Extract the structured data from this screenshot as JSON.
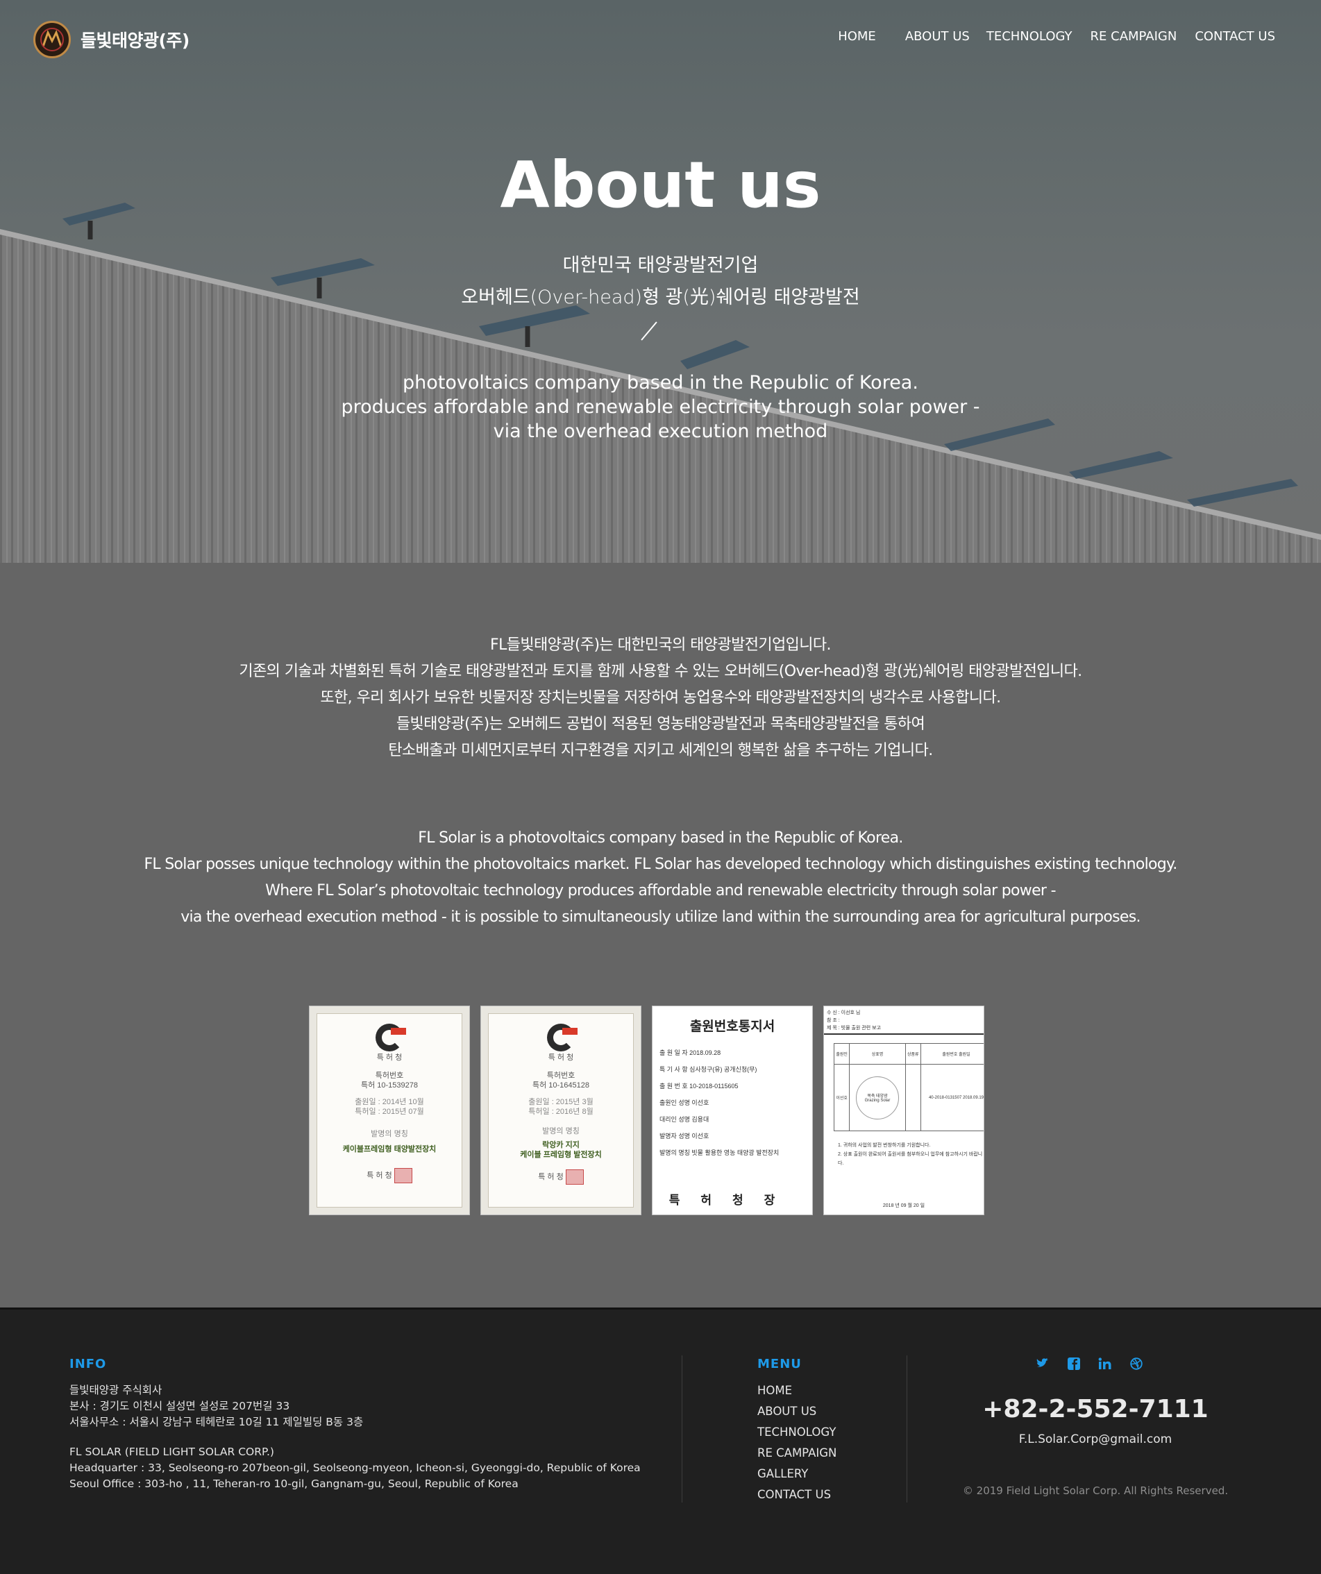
{
  "header": {
    "logo_text": "들빛태양광(주)",
    "nav": [
      "HOME",
      "ABOUT US",
      "TECHNOLOGY",
      "RE CAMPAIGN",
      "CONTACT US"
    ]
  },
  "hero": {
    "title": "About us",
    "ko_lines": [
      "대한민국 태양광발전기업",
      "오버헤드(Over-head)형 광(光)쉐어링 태양광발전"
    ],
    "en_lines": [
      "photovoltaics company based in the Republic of Korea.",
      "produces affordable and renewable electricity through solar power  -",
      "via the overhead execution method"
    ]
  },
  "intro_ko": [
    "FL들빛태양광(주)는 대한민국의 태양광발전기업입니다.",
    "기존의 기술과 차별화된 특허 기술로 태양광발전과 토지를 함께 사용할 수 있는 오버헤드(Over-head)형 광(光)쉐어링 태양광발전입니다.",
    "또한, 우리 회사가 보유한 빗물저장 장치는빗물을 저장하여 농업용수와 태양광발전장치의 냉각수로 사용합니다.",
    "들빛태양광(주)는 오버헤드 공법이 적용된 영농태양광발전과 목축태양광발전을 통하여",
    "탄소배출과 미세먼지로부터 지구환경을 지키고 세계인의 행복한 삶을 추구하는 기업니다."
  ],
  "intro_en": [
    "FL Solar is a photovoltaics company based in the Republic of Korea.",
    "FL Solar posses unique technology within the photovoltaics market.  FL Solar has developed technology which distinguishes existing technology.",
    "Where FL Solar’s photovoltaic technology produces affordable and renewable electricity through solar power  -",
    "via the overhead execution method - it is possible to simultaneously utilize land within the surrounding area for agricultural purposes."
  ],
  "certificates": {
    "cert1": {
      "office": "특 허 청",
      "number_label": "특허번호",
      "number": "특허 10-1539278",
      "filed": "출원일 : 2014년 10월",
      "granted": "특허일 : 2015년 07월",
      "invention_label": "발명의 명칭",
      "invention": "케이블프레임형 태양발전장치",
      "footer": "특    허    청"
    },
    "cert2": {
      "office": "특 허 청",
      "number_label": "특허번호",
      "number": "특허 10-1645128",
      "filed": "출원일 : 2015년 3월",
      "granted": "특허일 : 2016년 8월",
      "invention_label": "발명의 명칭",
      "invention_line1": "락앙카 지지",
      "invention_line2": "케이블 프레임형 발전장치",
      "footer": "특    허    청"
    },
    "cert3": {
      "title": "출원번호통지서",
      "rows": [
        "출 원 일 자   2018.09.28",
        "특 기 사 항   심사청구(유) 공개신청(무)",
        "출 원 번 호   10-2018-0115605",
        "출원인 성명   이선호",
        "대리인 성명   김용대",
        "발명자 성명   이선호",
        "발명의 명칭   빗물 활용한 영농 태양광 발전장치"
      ],
      "footer": "특허청장"
    },
    "cert4": {
      "memo_lines": [
        "수    신 : 이선호 님",
        "참    조 :",
        "제    목 : 빗물 출원 관련 보고"
      ],
      "headers": [
        "출원인",
        "상표명",
        "상품류",
        "출원번호 출원일"
      ],
      "row": [
        "이선호",
        "목축 태양광 Grazing Solar",
        "",
        "40-2018-0131507 2018.09.19"
      ],
      "notes": [
        "1. 귀하의 사업의 발전 번창하기를 기원합니다.",
        "2. 상표 출원이 완료되어 출원서를 첨부하오니 업무에 참고하시기 바랍니다."
      ],
      "date": "2018 년 09 월 20 일"
    }
  },
  "footer": {
    "info_heading": "INFO",
    "info_ko": [
      "들빛태양광 주식회사",
      "본사 : 경기도 이천시 설성면 설성로 207번길 33",
      "서울사무소 : 서울시 강남구 테헤란로 10길 11 제일빌딩 B동 3층"
    ],
    "info_en": [
      "FL SOLAR (FIELD LIGHT SOLAR CORP.)",
      "Headquarter : 33, Seolseong-ro 207beon-gil, Seolseong-myeon, Icheon-si, Gyeonggi-do, Republic of Korea",
      "Seoul Office : 303-ho , 11, Teheran-ro 10-gil, Gangnam-gu, Seoul, Republic of Korea"
    ],
    "menu_heading": "MENU",
    "menu": [
      "HOME",
      "ABOUT US",
      "TECHNOLOGY",
      "RE CAMPAIGN",
      "GALLERY",
      "CONTACT US"
    ],
    "socials": [
      "twitter-icon",
      "facebook-icon",
      "linkedin-icon",
      "dribbble-icon"
    ],
    "phone": "+82-2-552-7111",
    "email": "F.L.Solar.Corp@gmail.com",
    "copyright": "© 2019 Field Light Solar Corp. All Rights Reserved."
  },
  "colors": {
    "accent": "#1e9ae8",
    "footer_bg": "#202020",
    "body_bg": "#656565"
  }
}
